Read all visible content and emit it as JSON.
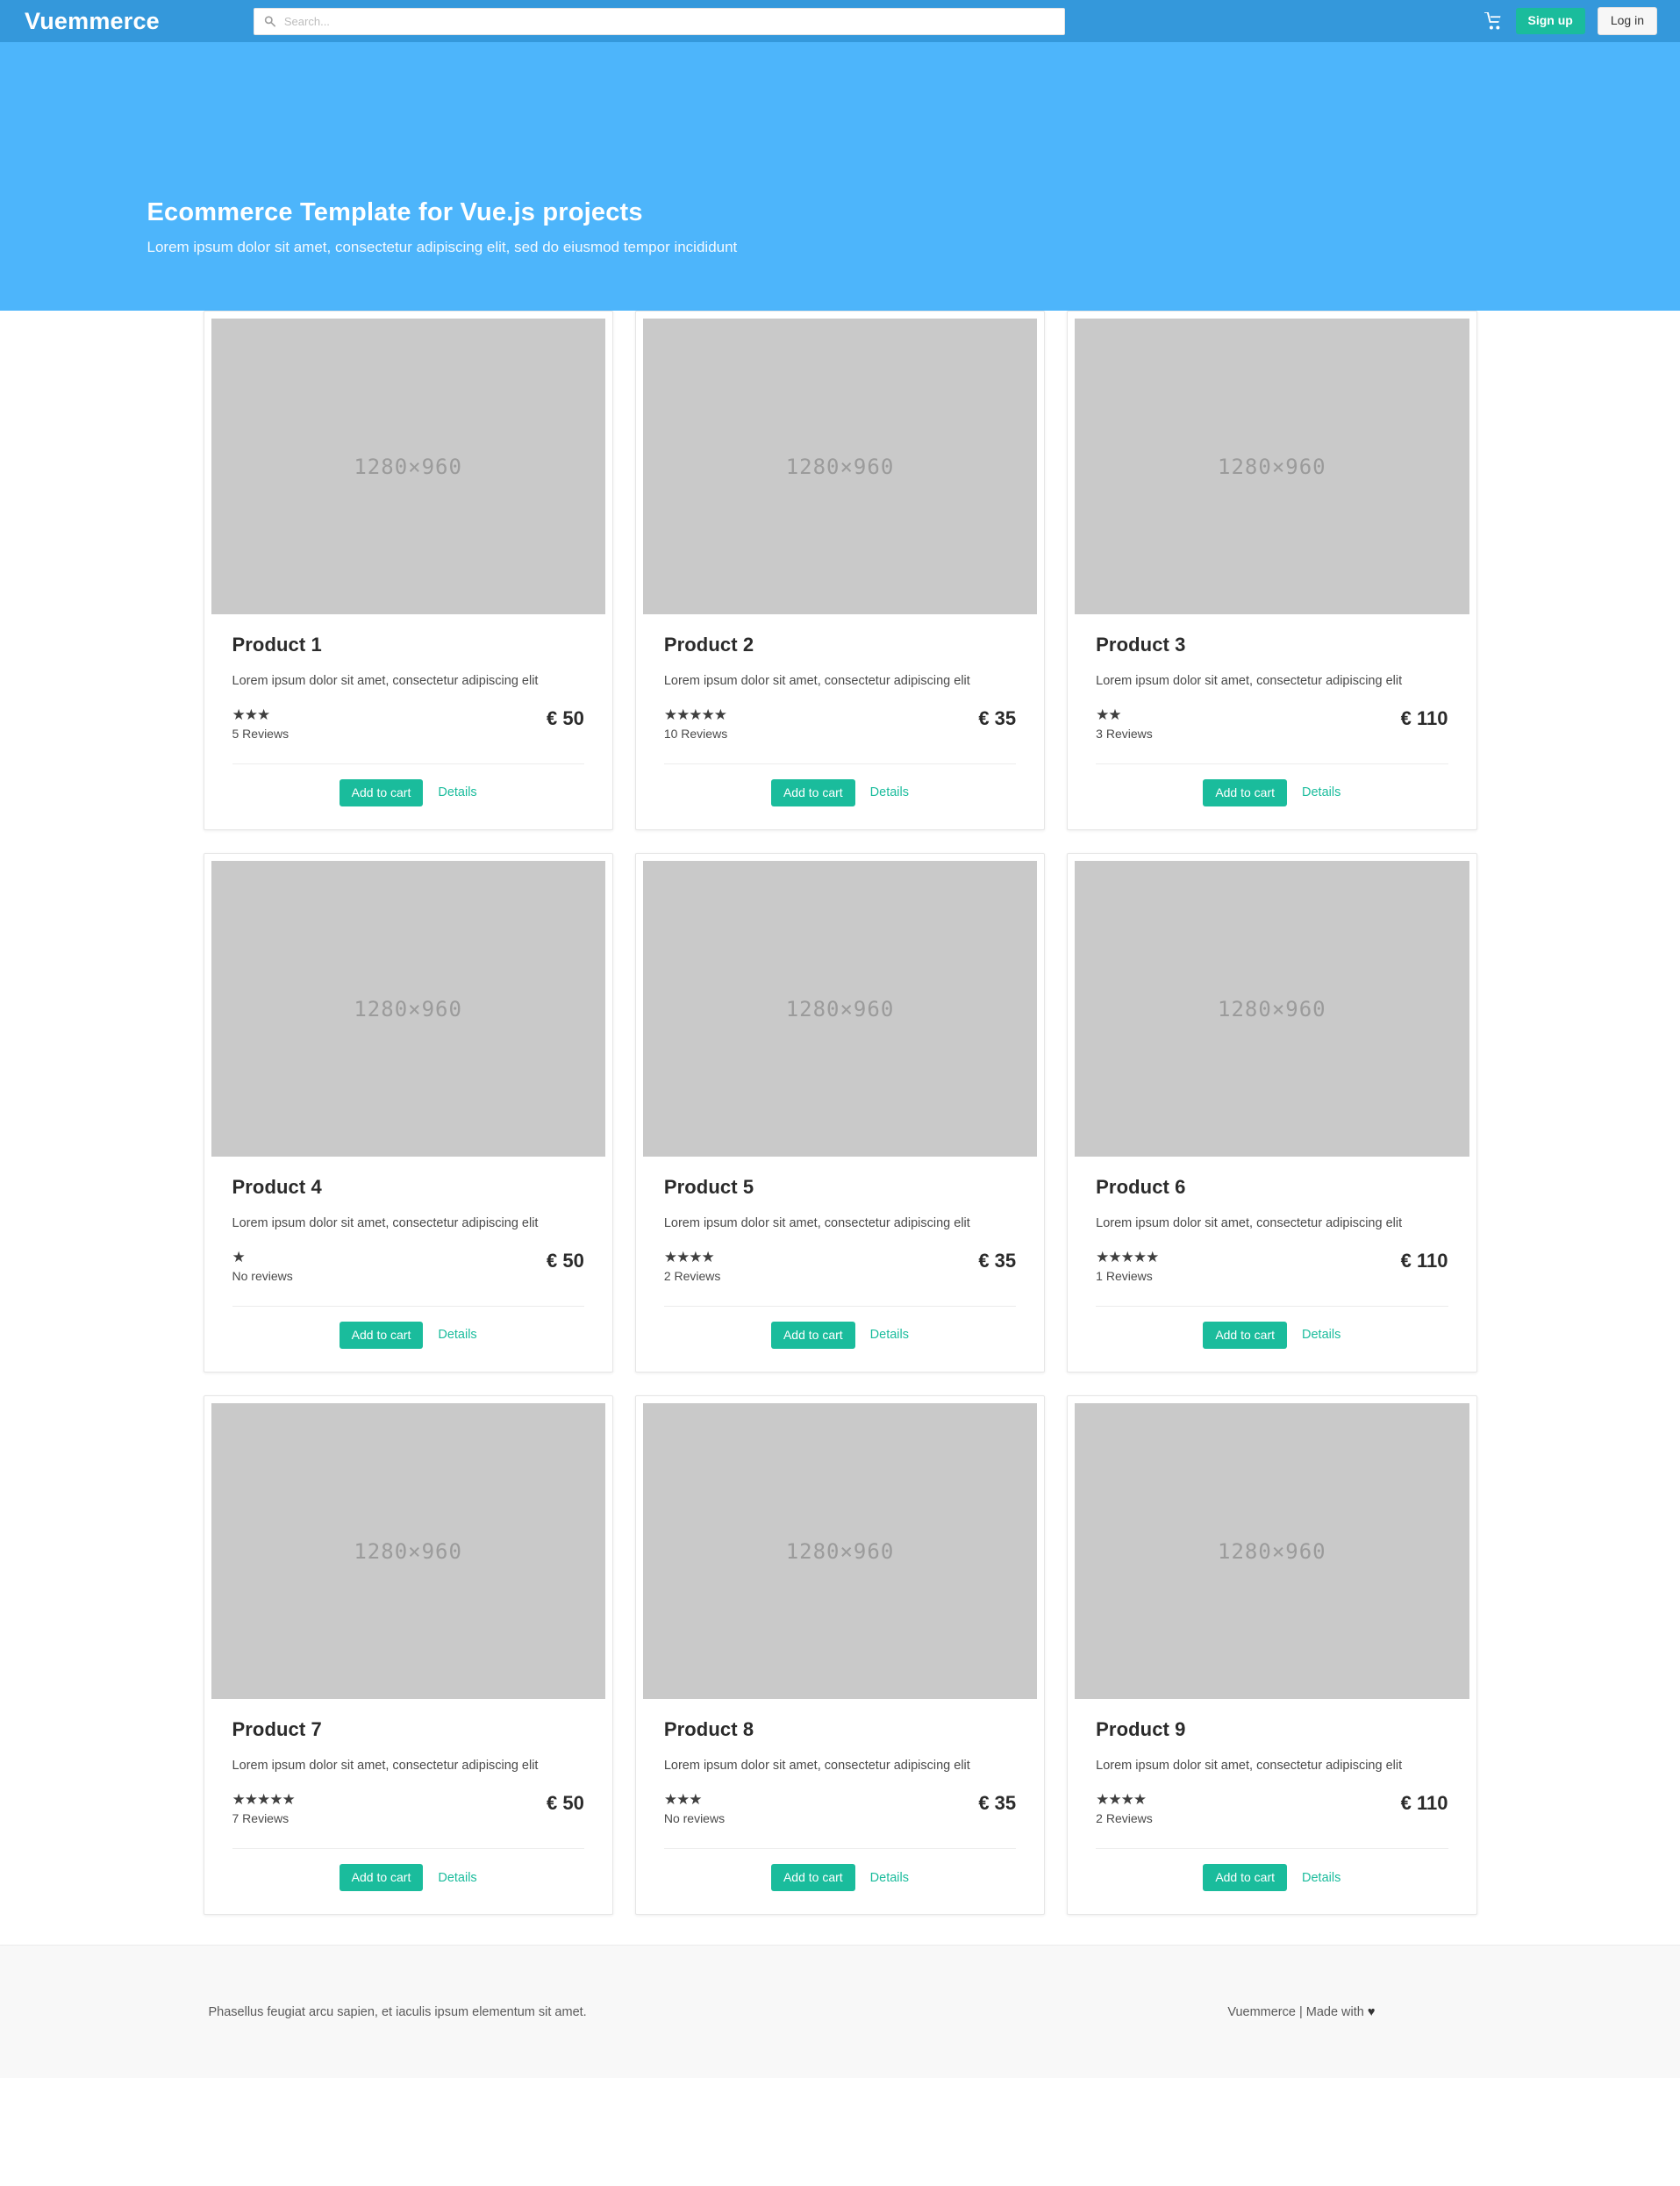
{
  "navbar": {
    "brand": "Vuemmerce",
    "search": {
      "placeholder": "Search...",
      "value": "",
      "icon": "search-icon"
    },
    "cart_icon": "shopping-cart-icon",
    "signup_label": "Sign up",
    "login_label": "Log in"
  },
  "hero": {
    "title": "Ecommerce Template for Vue.js projects",
    "subtitle": "Lorem ipsum dolor sit amet, consectetur adipiscing elit, sed do eiusmod tempor incididunt"
  },
  "products": [
    {
      "name": "Product 1",
      "description": "Lorem ipsum dolor sit amet, consectetur adipiscing elit",
      "image_label": "1280×960",
      "stars": "★★★",
      "rating": 3,
      "reviews": "5 Reviews",
      "price": "€ 50",
      "add_label": "Add to cart",
      "details_label": "Details"
    },
    {
      "name": "Product 2",
      "description": "Lorem ipsum dolor sit amet, consectetur adipiscing elit",
      "image_label": "1280×960",
      "stars": "★★★★★",
      "rating": 5,
      "reviews": "10 Reviews",
      "price": "€ 35",
      "add_label": "Add to cart",
      "details_label": "Details"
    },
    {
      "name": "Product 3",
      "description": "Lorem ipsum dolor sit amet, consectetur adipiscing elit",
      "image_label": "1280×960",
      "stars": "★★",
      "rating": 2,
      "reviews": "3 Reviews",
      "price": "€ 110",
      "add_label": "Add to cart",
      "details_label": "Details"
    },
    {
      "name": "Product 4",
      "description": "Lorem ipsum dolor sit amet, consectetur adipiscing elit",
      "image_label": "1280×960",
      "stars": "★",
      "rating": 1,
      "reviews": "No reviews",
      "price": "€ 50",
      "add_label": "Add to cart",
      "details_label": "Details"
    },
    {
      "name": "Product 5",
      "description": "Lorem ipsum dolor sit amet, consectetur adipiscing elit",
      "image_label": "1280×960",
      "stars": "★★★★",
      "rating": 4,
      "reviews": "2 Reviews",
      "price": "€ 35",
      "add_label": "Add to cart",
      "details_label": "Details"
    },
    {
      "name": "Product 6",
      "description": "Lorem ipsum dolor sit amet, consectetur adipiscing elit",
      "image_label": "1280×960",
      "stars": "★★★★★",
      "rating": 5,
      "reviews": "1 Reviews",
      "price": "€ 110",
      "add_label": "Add to cart",
      "details_label": "Details"
    },
    {
      "name": "Product 7",
      "description": "Lorem ipsum dolor sit amet, consectetur adipiscing elit",
      "image_label": "1280×960",
      "stars": "★★★★★",
      "rating": 5,
      "reviews": "7 Reviews",
      "price": "€ 50",
      "add_label": "Add to cart",
      "details_label": "Details"
    },
    {
      "name": "Product 8",
      "description": "Lorem ipsum dolor sit amet, consectetur adipiscing elit",
      "image_label": "1280×960",
      "stars": "★★★",
      "rating": 3,
      "reviews": "No reviews",
      "price": "€ 35",
      "add_label": "Add to cart",
      "details_label": "Details"
    },
    {
      "name": "Product 9",
      "description": "Lorem ipsum dolor sit amet, consectetur adipiscing elit",
      "image_label": "1280×960",
      "stars": "★★★★",
      "rating": 4,
      "reviews": "2 Reviews",
      "price": "€ 110",
      "add_label": "Add to cart",
      "details_label": "Details"
    }
  ],
  "footer": {
    "left_text": "Phasellus feugiat arcu sapien, et iaculis ipsum elementum sit amet.",
    "right_text": "Vuemmerce | Made with ",
    "heart": "♥"
  },
  "colors": {
    "navbar_blue": "#3498db",
    "hero_blue": "#4db5fb",
    "accent_teal": "#1abc9c",
    "placeholder_gray": "#c9c9c9",
    "footer_bg": "#f8f8f8"
  }
}
